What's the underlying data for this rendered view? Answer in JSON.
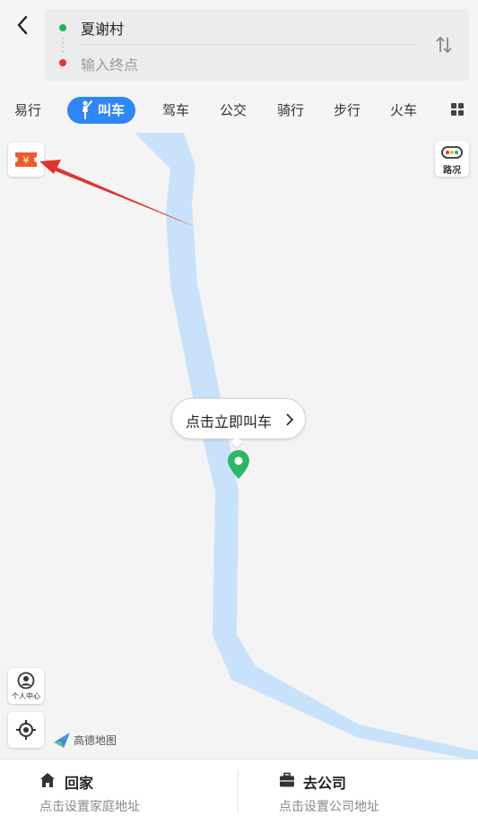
{
  "header": {
    "origin": "夏谢村",
    "destination_placeholder": "输入终点"
  },
  "modes": [
    {
      "label": "易行"
    },
    {
      "label": "叫车",
      "active": true
    },
    {
      "label": "驾车"
    },
    {
      "label": "公交"
    },
    {
      "label": "骑行"
    },
    {
      "label": "步行"
    },
    {
      "label": "火车"
    }
  ],
  "map": {
    "coupon_symbol": "¥",
    "traffic_label": "路况",
    "callout_text": "点击立即叫车",
    "user_center_label": "个人中心",
    "logo_text": "高德地图"
  },
  "shortcuts": {
    "home": {
      "title": "回家",
      "subtitle": "点击设置家庭地址"
    },
    "company": {
      "title": "去公司",
      "subtitle": "点击设置公司地址"
    }
  },
  "colors": {
    "accent": "#2f86f6",
    "start_dot": "#1db855",
    "end_dot": "#e5342c",
    "pin": "#2cb866",
    "river": "#c9e2fb",
    "coupon": "#f05a28",
    "annotation_arrow": "#e3322b"
  },
  "icons": {
    "back": "chevron-left-icon",
    "swap": "swap-icon",
    "more": "grid-icon",
    "coupon": "coupon-icon",
    "traffic": "traffic-light-icon",
    "user": "user-icon",
    "locate": "locate-icon",
    "home": "home-icon",
    "company": "briefcase-icon"
  }
}
